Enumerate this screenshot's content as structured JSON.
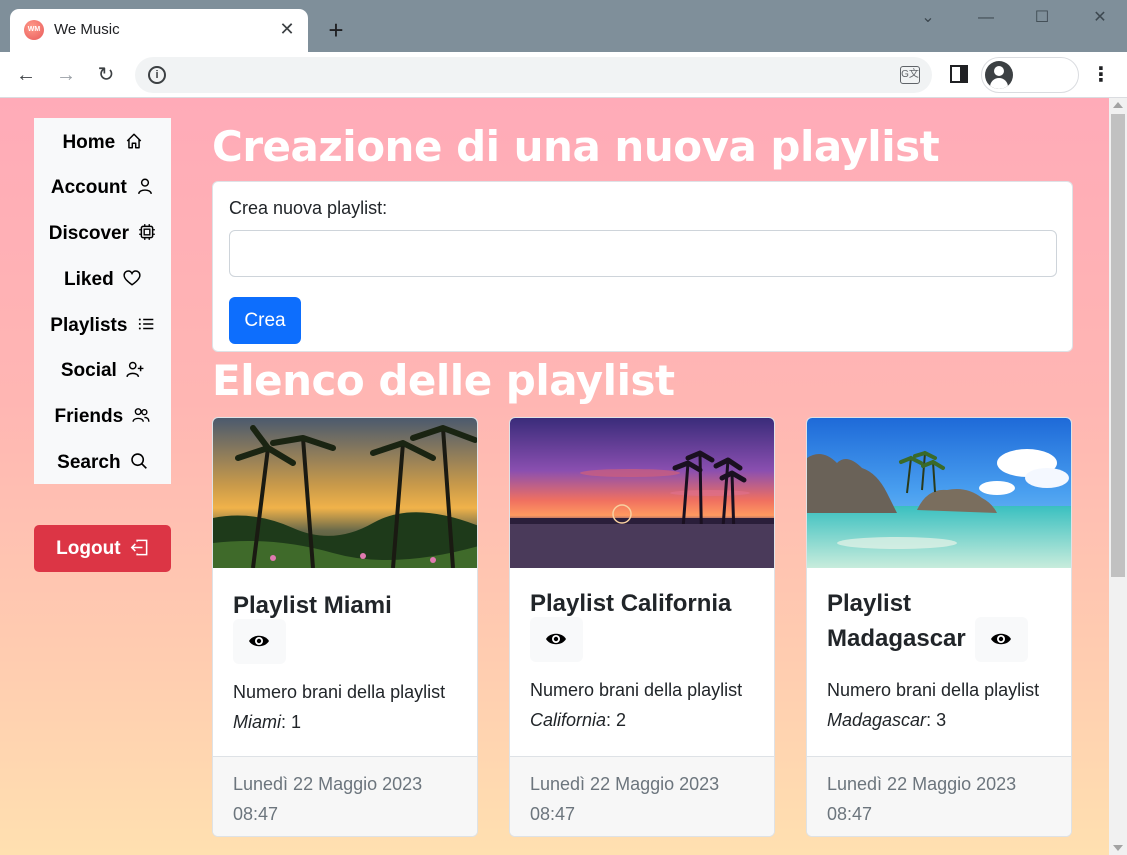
{
  "browser": {
    "tab_title": "We Music",
    "favicon_text": "WM",
    "tab_close": "✕",
    "new_tab": "+",
    "controls": {
      "chevron": "⌄",
      "minimize": "—",
      "maximize": "☐",
      "close": "✕"
    },
    "nav": {
      "back": "←",
      "forward": "→",
      "reload": "↻"
    },
    "info_icon": "i",
    "translate_icon": "G文",
    "menu": "⋮"
  },
  "sidebar": {
    "items": [
      {
        "label": "Home",
        "icon": "home-icon"
      },
      {
        "label": "Account",
        "icon": "person-icon"
      },
      {
        "label": "Discover",
        "icon": "cpu-icon"
      },
      {
        "label": "Liked",
        "icon": "heart-icon"
      },
      {
        "label": "Playlists",
        "icon": "list-icon"
      },
      {
        "label": "Social",
        "icon": "person-plus-icon"
      },
      {
        "label": "Friends",
        "icon": "people-icon"
      },
      {
        "label": "Search",
        "icon": "search-icon"
      }
    ],
    "logout": {
      "label": "Logout",
      "icon": "box-arrow-left-icon"
    }
  },
  "main": {
    "create_title": "Creazione di una nuova playlist",
    "form_label": "Crea nuova playlist:",
    "input_value": "",
    "create_button": "Crea",
    "list_title": "Elenco delle playlist"
  },
  "playlists": [
    {
      "title": "Playlist Miami",
      "count_prefix": "Numero brani della playlist ",
      "name": "Miami",
      "count_suffix": ": 1",
      "date": "Lunedì 22 Maggio 2023 08:47"
    },
    {
      "title": "Playlist California",
      "count_prefix": "Numero brani della playlist ",
      "name": "California",
      "count_suffix": ": 2",
      "date": "Lunedì 22 Maggio 2023 08:47"
    },
    {
      "title": "Playlist Madagascar",
      "count_prefix": "Numero brani della playlist ",
      "name": "Madagascar",
      "count_suffix": ": 3",
      "date": "Lunedì 22 Maggio 2023 08:47"
    }
  ],
  "colors": {
    "logout": "#dc3545",
    "primary": "#0d6efd",
    "gradient_top": "#ffabb8",
    "gradient_bottom": "#ffe0b0"
  }
}
